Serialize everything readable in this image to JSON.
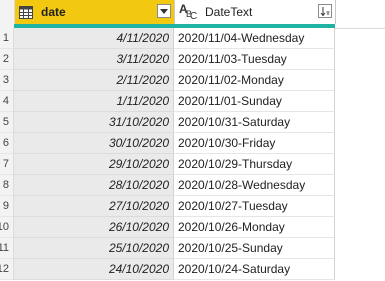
{
  "columns": {
    "date": {
      "label": "date",
      "type_icon": "calendar-icon"
    },
    "datetext": {
      "label": "DateText",
      "type_icon": "abc-text-type-icon"
    }
  },
  "accent_color": "#1fb3a3",
  "selected_header_color": "#f2c811",
  "rows": [
    {
      "num": "1",
      "date": "4/11/2020",
      "text": "2020/11/04-Wednesday"
    },
    {
      "num": "2",
      "date": "3/11/2020",
      "text": "2020/11/03-Tuesday"
    },
    {
      "num": "3",
      "date": "2/11/2020",
      "text": "2020/11/02-Monday"
    },
    {
      "num": "4",
      "date": "1/11/2020",
      "text": "2020/11/01-Sunday"
    },
    {
      "num": "5",
      "date": "31/10/2020",
      "text": "2020/10/31-Saturday"
    },
    {
      "num": "6",
      "date": "30/10/2020",
      "text": "2020/10/30-Friday"
    },
    {
      "num": "7",
      "date": "29/10/2020",
      "text": "2020/10/29-Thursday"
    },
    {
      "num": "8",
      "date": "28/10/2020",
      "text": "2020/10/28-Wednesday"
    },
    {
      "num": "9",
      "date": "27/10/2020",
      "text": "2020/10/27-Tuesday"
    },
    {
      "num": "10",
      "date": "26/10/2020",
      "text": "2020/10/26-Monday"
    },
    {
      "num": "11",
      "date": "25/10/2020",
      "text": "2020/10/25-Sunday"
    },
    {
      "num": "12",
      "date": "24/10/2020",
      "text": "2020/10/24-Saturday"
    }
  ]
}
